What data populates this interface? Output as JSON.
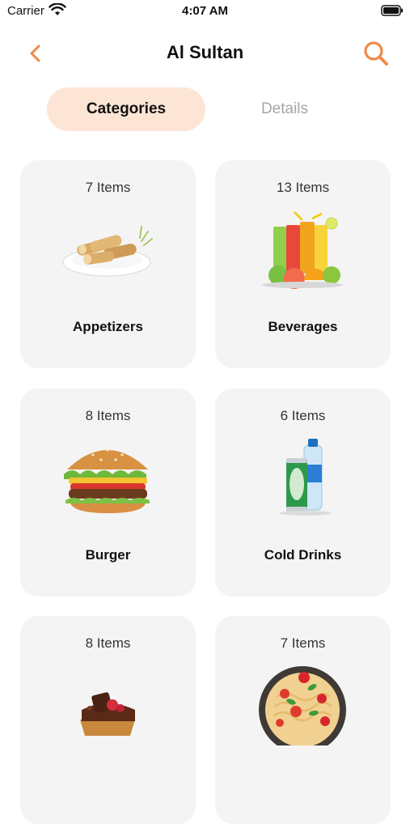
{
  "status": {
    "carrier": "Carrier",
    "time": "4:07 AM"
  },
  "nav": {
    "title": "Al Sultan"
  },
  "tabs": [
    {
      "label": "Categories",
      "active": true
    },
    {
      "label": "Details",
      "active": false
    }
  ],
  "colors": {
    "accent": "#ef8a4a",
    "active_tab_bg": "#fde5d6",
    "card_bg": "#f4f4f4"
  },
  "categories": [
    {
      "count": "7 Items",
      "name": "Appetizers",
      "image": "spring-rolls"
    },
    {
      "count": "13 Items",
      "name": "Beverages",
      "image": "juices"
    },
    {
      "count": "8 Items",
      "name": "Burger",
      "image": "burger"
    },
    {
      "count": "6 Items",
      "name": "Cold Drinks",
      "image": "soda-and-water"
    },
    {
      "count": "8 Items",
      "name": "",
      "image": "cake"
    },
    {
      "count": "7 Items",
      "name": "",
      "image": "pasta"
    }
  ]
}
